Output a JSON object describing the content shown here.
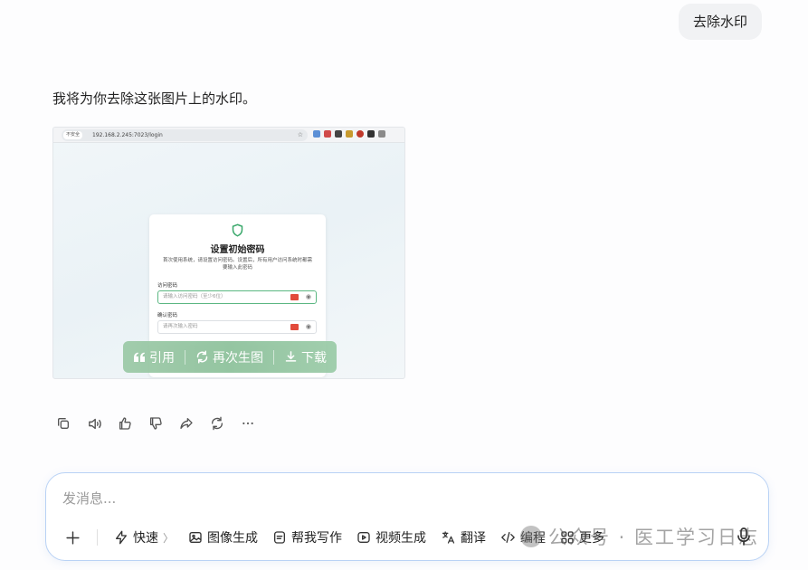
{
  "conversation": {
    "user_message": "去除水印",
    "assistant_reply": "我将为你去除这张图片上的水印。"
  },
  "generated_image": {
    "browser": {
      "insecure_label": "不安全",
      "url": "192.168.2.245:7023/login"
    },
    "dialog": {
      "title": "设置初始密码",
      "description": "首次使用系统，请设置访问密码。设置后，所有用户访问系统时都需要输入此密码",
      "field1_label": "访问密码",
      "field1_placeholder": "请输入访问密码（至少6位）",
      "field2_label": "确认密码",
      "field2_placeholder": "请再次输入密码"
    },
    "actions": {
      "quote": "引用",
      "regenerate": "再次生图",
      "download": "下载"
    }
  },
  "composer": {
    "placeholder": "发消息...",
    "tools": {
      "quick": "快速",
      "image_gen": "图像生成",
      "writing": "帮我写作",
      "video_gen": "视频生成",
      "translate": "翻译",
      "coding": "编程",
      "more": "更多"
    }
  },
  "watermark": {
    "text": "公众号 · 医工学习日志"
  },
  "colors": {
    "accent_border": "#b9d2f5",
    "overlay_green": "#8fc29d",
    "focus_green": "#5bb782"
  }
}
